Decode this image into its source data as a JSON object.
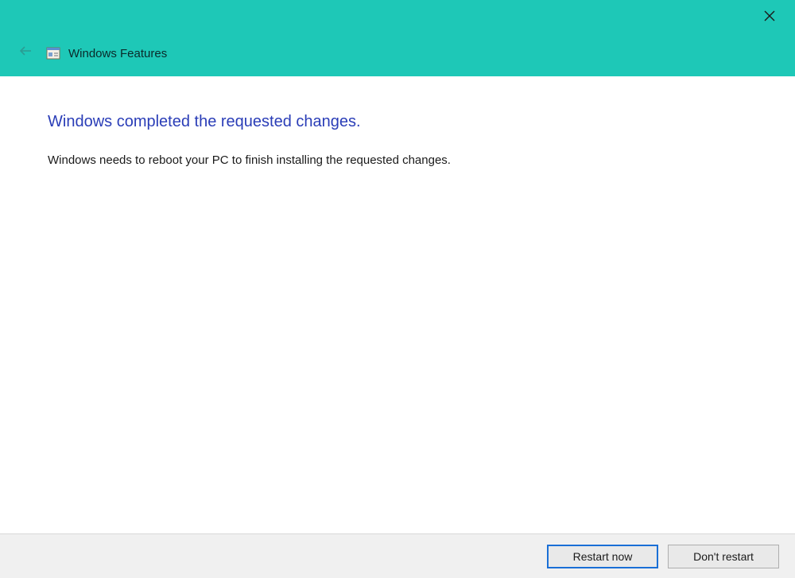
{
  "titlebar": {
    "title": "Windows Features"
  },
  "content": {
    "heading": "Windows completed the requested changes.",
    "body": "Windows needs to reboot your PC to finish installing the requested changes."
  },
  "footer": {
    "primary_label": "Restart now",
    "secondary_label": "Don't restart"
  }
}
